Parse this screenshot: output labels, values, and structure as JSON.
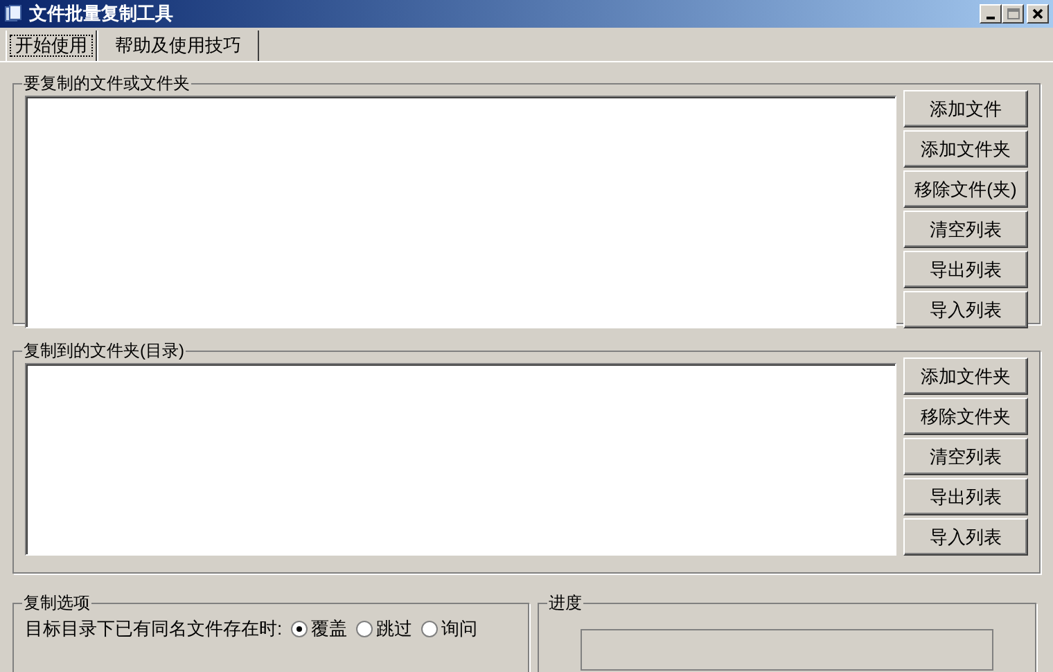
{
  "window": {
    "title": "文件批量复制工具"
  },
  "tabs": [
    {
      "label": "开始使用",
      "selected": true
    },
    {
      "label": "帮助及使用技巧",
      "selected": false
    }
  ],
  "source_group": {
    "title": "要复制的文件或文件夹",
    "buttons": [
      "添加文件",
      "添加文件夹",
      "移除文件(夹)",
      "清空列表",
      "导出列表",
      "导入列表"
    ]
  },
  "target_group": {
    "title": "复制到的文件夹(目录)",
    "buttons": [
      "添加文件夹",
      "移除文件夹",
      "清空列表",
      "导出列表",
      "导入列表"
    ]
  },
  "options_group": {
    "title": "复制选项",
    "prompt": "目标目录下已有同名文件存在时:",
    "choices": [
      {
        "label": "覆盖",
        "selected": true
      },
      {
        "label": "跳过",
        "selected": false
      },
      {
        "label": "询问",
        "selected": false
      }
    ]
  },
  "progress_group": {
    "title": "进度"
  }
}
